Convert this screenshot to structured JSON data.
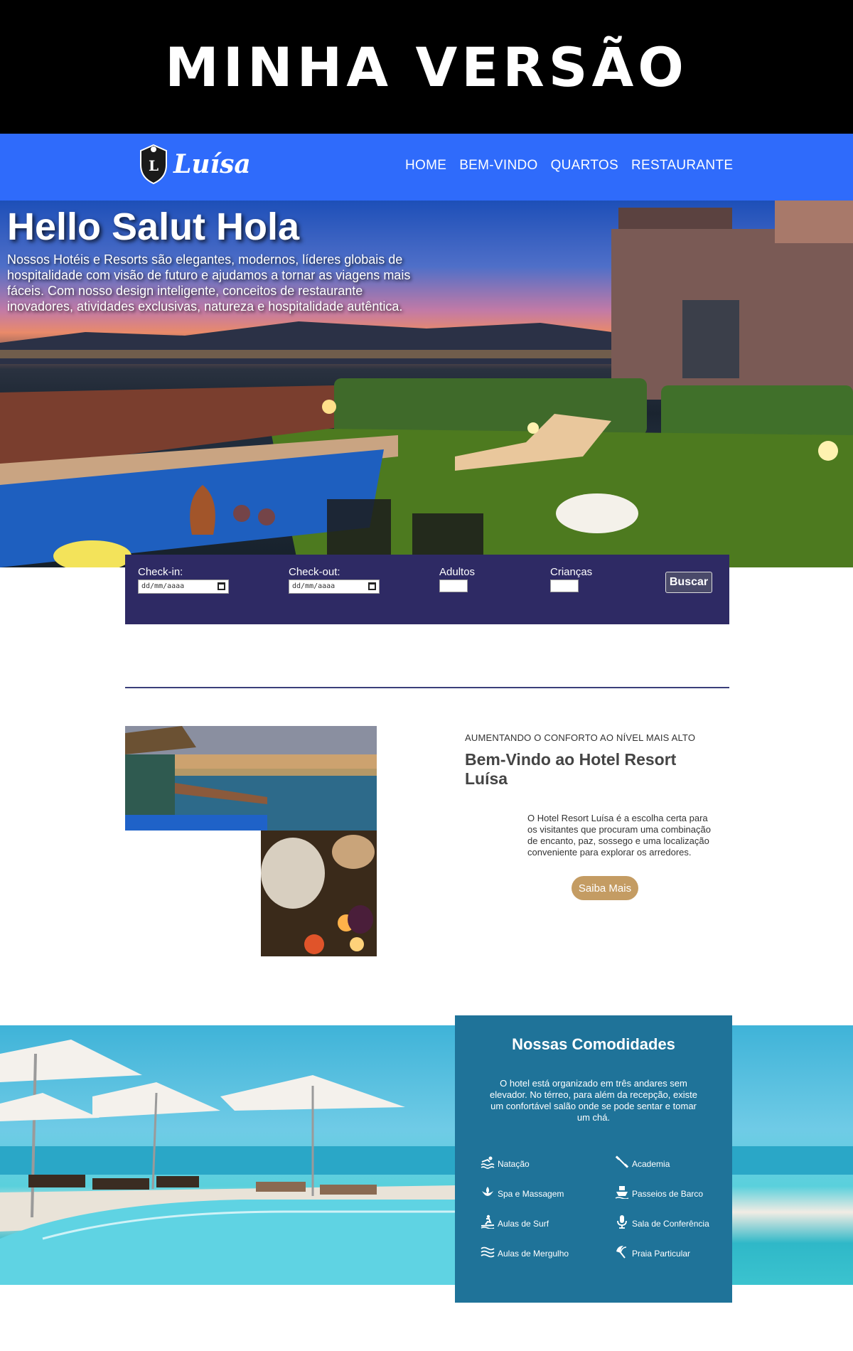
{
  "banner": {
    "title": "MINHA VERSÃO"
  },
  "brand": {
    "name": "Luísa"
  },
  "nav": {
    "items": [
      "HOME",
      "BEM-VINDO",
      "QUARTOS",
      "RESTAURANTE"
    ]
  },
  "hero": {
    "title": "Hello Salut Hola",
    "text": "Nossos Hotéis e Resorts são elegantes, modernos, líderes globais de hospitalidade com visão de futuro e ajudamos a tornar as viagens mais fáceis. Com nosso design inteligente, conceitos de restaurante inovadores, atividades exclusivas, natureza e hospitalidade autêntica."
  },
  "booking": {
    "checkin_label": "Check-in:",
    "checkout_label": "Check-out:",
    "adults_label": "Adultos",
    "children_label": "Crianças",
    "date_placeholder": "dd/mm/aaaa",
    "button": "Buscar"
  },
  "welcome": {
    "kicker": "AUMENTANDO O CONFORTO AO NÍVEL MAIS ALTO",
    "title": "Bem-Vindo ao Hotel Resort Luísa",
    "text": "O Hotel Resort Luísa é a escolha certa para os visitantes que procuram uma combinação de encanto, paz, sossego e uma localização conveniente para explorar os arredores.",
    "button": "Saiba Mais"
  },
  "amenities": {
    "title": "Nossas Comodidades",
    "text": "O hotel está organizado em três andares sem elevador. No térreo, para além da recepção, existe um confortável salão onde se pode sentar e tomar um chá.",
    "items": [
      {
        "label": "Natação",
        "icon": "swimming-icon"
      },
      {
        "label": "Academia",
        "icon": "dumbbell-icon"
      },
      {
        "label": "Spa e Massagem",
        "icon": "spa-icon"
      },
      {
        "label": "Passeios de Barco",
        "icon": "ship-icon"
      },
      {
        "label": "Aulas de Surf",
        "icon": "surf-icon"
      },
      {
        "label": "Sala de Conferência",
        "icon": "microphone-icon"
      },
      {
        "label": "Aulas de Mergulho",
        "icon": "water-icon"
      },
      {
        "label": "Praia Particular",
        "icon": "umbrella-beach-icon"
      }
    ]
  },
  "colors": {
    "nav_bg": "#2f6bfb",
    "booking_bg": "#2e2a64",
    "button_gold": "#c49c63",
    "amenities_bg": "#1f7399"
  }
}
